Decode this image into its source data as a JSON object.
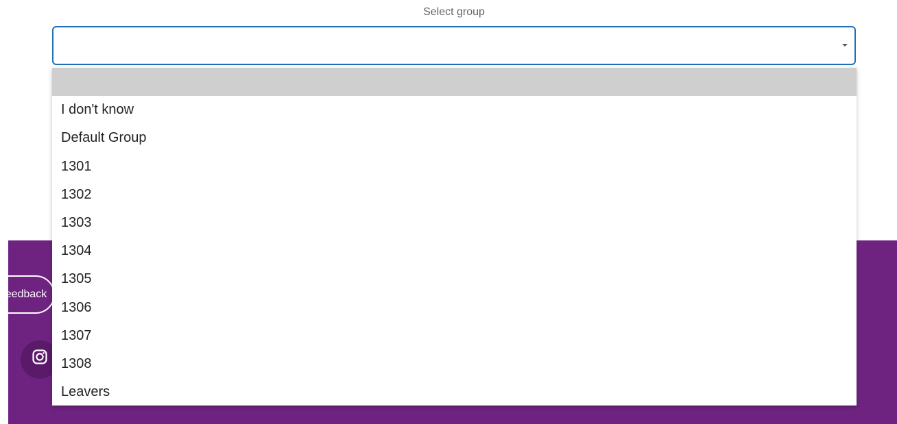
{
  "select": {
    "label": "Select group",
    "value": "",
    "options": [
      "",
      "I don't know",
      "Default Group",
      "1301",
      "1302",
      "1303",
      "1304",
      "1305",
      "1306",
      "1307",
      "1308",
      "Leavers"
    ]
  },
  "footer": {
    "button_label": "Feedback",
    "social_icon": "instagram-icon",
    "background_color": "#6f2381"
  },
  "colors": {
    "focus_border": "#1e6fb8",
    "highlight": "#cfcfcf"
  }
}
